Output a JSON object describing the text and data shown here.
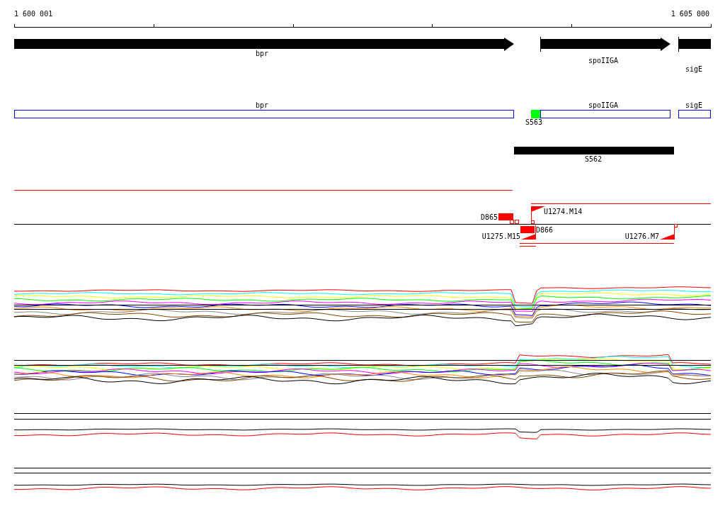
{
  "ruler": {
    "start_label": "1 600 001",
    "end_label": "1 605 000"
  },
  "genes": [
    {
      "name": "bpr"
    },
    {
      "name": "spoIIGA"
    },
    {
      "name": "sigE"
    }
  ],
  "cds": [
    {
      "name": "bpr"
    },
    {
      "name": "spoIIGA"
    },
    {
      "name": "sigE"
    }
  ],
  "markers": [
    {
      "label": "S563"
    }
  ],
  "segments": [
    {
      "label": "S562"
    }
  ],
  "features": [
    {
      "label": "U1274.M14",
      "kind": "up"
    },
    {
      "label": "D865",
      "kind": "block"
    },
    {
      "label": "D866",
      "kind": "block"
    },
    {
      "label": "U1275.M15",
      "kind": "down"
    },
    {
      "label": "U1276.M7",
      "kind": "down"
    }
  ]
}
